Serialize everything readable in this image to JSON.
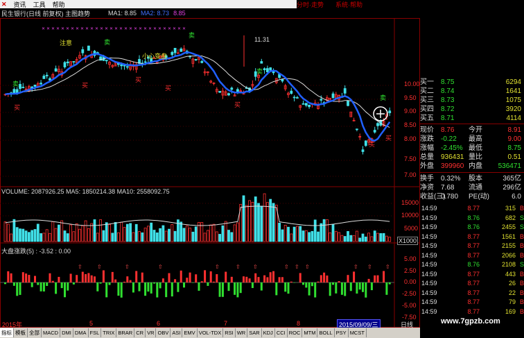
{
  "menu": {
    "items": [
      "资讯",
      "工具",
      "帮助"
    ],
    "close_glyph": "✕",
    "red_items": [
      "分时·走势",
      "系统·帮助"
    ]
  },
  "title_bar": {
    "stock_title": "民生银行(日线 前复权) 主图趋势",
    "ma1_label": "MA1: 8.85",
    "ma2_label": "MA2: 8.73",
    "ma3_label": "8.85"
  },
  "main_chart": {
    "annotations": {
      "zhuyi": "注意",
      "xinxin": "小心变盘",
      "high": "11.31"
    },
    "signal_buy": "买",
    "signal_sell": "卖",
    "y_ticks": [
      "10.00",
      "9.50",
      "9.00",
      "8.50",
      "8.00",
      "7.50",
      "7.00"
    ]
  },
  "volume_panel": {
    "label": "VOLUME: 2087926.25  MA5: 1850214.38  MA10: 2558092.75",
    "y_ticks": [
      "15000",
      "10000",
      "5000"
    ],
    "unit": "X1000"
  },
  "indicator_panel": {
    "label": "大盘涨跌(5) : -3.52   : 0.00",
    "y_ticks": [
      "5.00",
      "2.50",
      "0.00",
      "-2.50",
      "-5.00",
      "-7.50"
    ]
  },
  "date_axis": {
    "year": "2015年",
    "months": [
      "5",
      "6",
      "7",
      "8"
    ],
    "cursor_date": "2015/09/09/三",
    "period": "日线"
  },
  "quote": {
    "bids": [
      {
        "label": "买一",
        "price": "8.75",
        "vol": "6294"
      },
      {
        "label": "买二",
        "price": "8.74",
        "vol": "1641"
      },
      {
        "label": "买三",
        "price": "8.73",
        "vol": "1075"
      },
      {
        "label": "买四",
        "price": "8.72",
        "vol": "3920"
      },
      {
        "label": "买五",
        "price": "8.71",
        "vol": "4114"
      }
    ],
    "stats": [
      {
        "l1": "现价",
        "v1": "8.76",
        "l2": "今开",
        "v2": "8.91",
        "c1": "r",
        "c2": "r"
      },
      {
        "l1": "涨跌",
        "v1": "-0.22",
        "l2": "最高",
        "v2": "9.00",
        "c1": "g",
        "c2": "r"
      },
      {
        "l1": "涨幅",
        "v1": "-2.45%",
        "l2": "最低",
        "v2": "8.75",
        "c1": "g",
        "c2": "g"
      },
      {
        "l1": "总量",
        "v1": "936431",
        "l2": "量比",
        "v2": "0.51",
        "c1": "y",
        "c2": "y"
      },
      {
        "l1": "外盘",
        "v1": "399960",
        "l2": "内盘",
        "v2": "536471",
        "c1": "r",
        "c2": "g"
      }
    ],
    "stats2": [
      {
        "l1": "换手",
        "v1": "0.32%",
        "l2": "股本",
        "v2": "365亿",
        "c1": "w",
        "c2": "w"
      },
      {
        "l1": "净资",
        "v1": "7.68",
        "l2": "流通",
        "v2": "296亿",
        "c1": "w",
        "c2": "w"
      },
      {
        "l1": "收益(三)",
        "v1": "0.780",
        "l2": "PE(动)",
        "v2": "6.0",
        "c1": "w",
        "c2": "w"
      }
    ]
  },
  "ticks": [
    {
      "time": "14:59",
      "price": "8.77",
      "vol": "315",
      "dir": "B"
    },
    {
      "time": "14:59",
      "price": "8.76",
      "vol": "682",
      "dir": "S"
    },
    {
      "time": "14:59",
      "price": "8.76",
      "vol": "2455",
      "dir": "S"
    },
    {
      "time": "14:59",
      "price": "8.77",
      "vol": "1561",
      "dir": "B"
    },
    {
      "time": "14:59",
      "price": "8.77",
      "vol": "2155",
      "dir": "B"
    },
    {
      "time": "14:59",
      "price": "8.77",
      "vol": "2066",
      "dir": "B"
    },
    {
      "time": "14:59",
      "price": "8.76",
      "vol": "2108",
      "dir": "S"
    },
    {
      "time": "14:59",
      "price": "8.77",
      "vol": "443",
      "dir": "B"
    },
    {
      "time": "14:59",
      "price": "8.77",
      "vol": "26",
      "dir": "B"
    },
    {
      "time": "14:59",
      "price": "8.77",
      "vol": "22",
      "dir": "B"
    },
    {
      "time": "14:59",
      "price": "8.77",
      "vol": "79",
      "dir": "B"
    },
    {
      "time": "14:59",
      "price": "8.77",
      "vol": "169",
      "dir": "B"
    }
  ],
  "tabs": [
    "指标",
    "模板",
    "全部",
    "MACD",
    "DMI",
    "DMA",
    "FSL",
    "TRIX",
    "BRAR",
    "CR",
    "VR",
    "OBV",
    "ASI",
    "EMV",
    "VOL-TDX",
    "RSI",
    "WR",
    "SAR",
    "KDJ",
    "CCI",
    "ROC",
    "MTM",
    "BOLL",
    "PSY",
    "MCST"
  ],
  "watermark": "www.7gpzb.com",
  "colors": {
    "up": "#ff3030",
    "down": "#40e0e8",
    "ma_blue": "#2060ff",
    "ind_green": "#30e030"
  }
}
